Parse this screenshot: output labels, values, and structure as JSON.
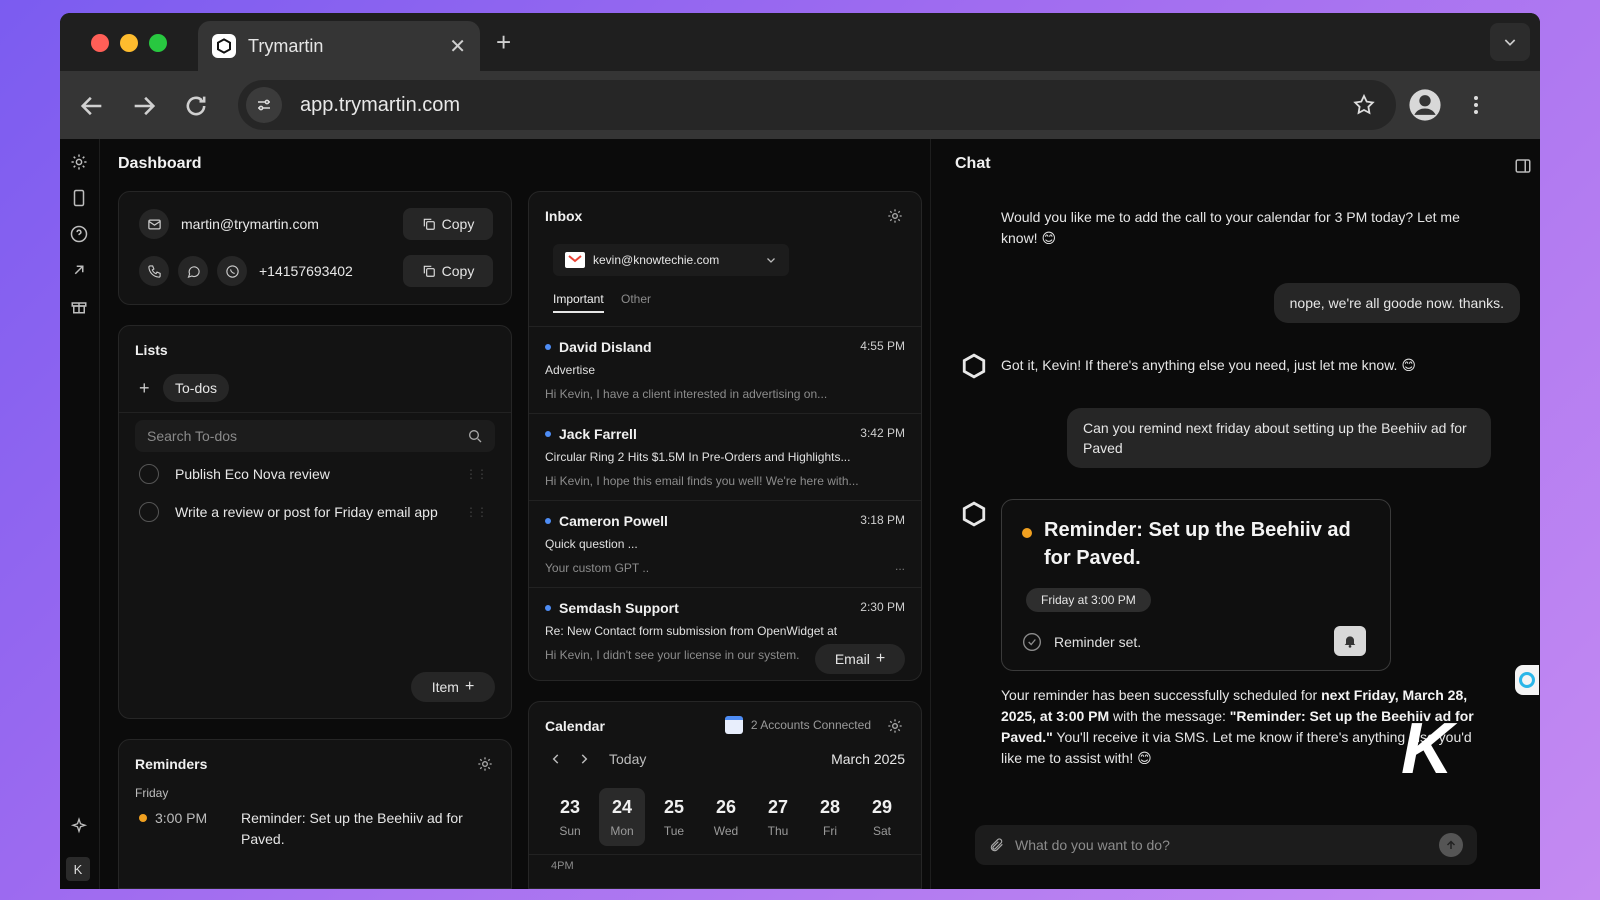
{
  "browser": {
    "tab_title": "Trymartin",
    "url": "app.trymartin.com"
  },
  "colors": {
    "accent_orange": "#f0a020",
    "unread_dot": "#4e8df5",
    "gmail_red": "#ea4335"
  },
  "dashboard": {
    "title": "Dashboard",
    "contact": {
      "email": "martin@trymartin.com",
      "phone": "+14157693402",
      "copy_label": "Copy"
    },
    "lists": {
      "title": "Lists",
      "add": "+",
      "tab": "To-dos",
      "search_placeholder": "Search To-dos",
      "items": [
        "Publish Eco Nova review",
        "Write a review or post for Friday email app"
      ],
      "item_button": "Item"
    },
    "reminders": {
      "title": "Reminders",
      "day": "Friday",
      "time": "3:00 PM",
      "text": "Reminder: Set up the Beehiiv ad for Paved."
    },
    "inbox": {
      "title": "Inbox",
      "account": "kevin@knowtechie.com",
      "tabs": [
        "Important",
        "Other"
      ],
      "emails": [
        {
          "from": "David Disland",
          "time": "4:55 PM",
          "subject": "Advertise",
          "preview": "Hi Kevin, I have a client interested in advertising on..."
        },
        {
          "from": "Jack Farrell",
          "time": "3:42 PM",
          "subject": "Circular Ring 2 Hits $1.5M In Pre-Orders and Highlights...",
          "preview": "Hi Kevin, I hope this email finds you well! We're here with..."
        },
        {
          "from": "Cameron Powell",
          "time": "3:18 PM",
          "subject": "Quick question ...",
          "preview": "Your custom GPT .."
        },
        {
          "from": "Semdash Support",
          "time": "2:30 PM",
          "subject": "Re: New Contact form submission from OpenWidget at",
          "preview": "Hi Kevin, I didn't see your license in our system."
        }
      ],
      "email_button": "Email"
    },
    "calendar": {
      "title": "Calendar",
      "accounts": "2 Accounts Connected",
      "today": "Today",
      "month": "March 2025",
      "days": [
        {
          "n": "23",
          "w": "Sun"
        },
        {
          "n": "24",
          "w": "Mon"
        },
        {
          "n": "25",
          "w": "Tue"
        },
        {
          "n": "26",
          "w": "Wed"
        },
        {
          "n": "27",
          "w": "Thu"
        },
        {
          "n": "28",
          "w": "Fri"
        },
        {
          "n": "29",
          "w": "Sat"
        }
      ],
      "hour": "4PM"
    }
  },
  "chat": {
    "title": "Chat",
    "m1": "Would you like me to add the call to your calendar for 3 PM today? Let me know! 😊",
    "u1": "nope, we're all goode now. thanks.",
    "m2": "Got it, Kevin! If there's anything else you need, just let me know. 😊",
    "u2": "Can you remind next friday about setting up the Beehiiv ad for Paved",
    "reminder_title": "Reminder: Set up the Beehiiv ad for Paved.",
    "reminder_chip": "Friday at 3:00 PM",
    "reminder_status": "Reminder set.",
    "m3a": "Your reminder has been successfully scheduled for ",
    "m3b": "next Friday, March 28, 2025, at 3:00 PM",
    "m3c": " with the message: ",
    "m3d": "\"Reminder: Set up the Beehiiv ad for Paved.\"",
    "m3e": " You'll receive it via SMS. Let me know if there's anything else you'd like me to assist with! 😊",
    "input_placeholder": "What do you want to do?",
    "watermark": "K",
    "user_initial": "K"
  }
}
